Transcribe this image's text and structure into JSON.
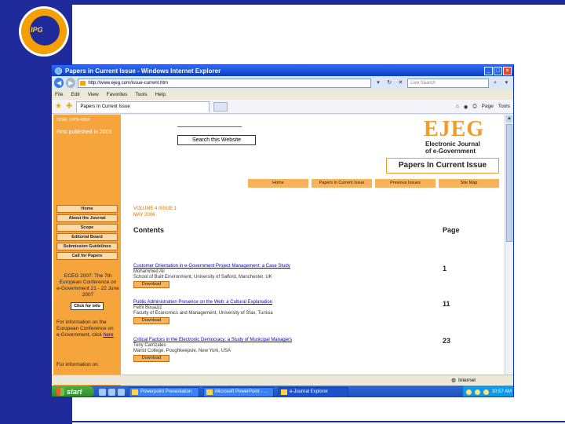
{
  "browser": {
    "window_title": "Papers in Current Issue - Windows Internet Explorer",
    "url": "http://www.ejeg.com/issue-current.htm",
    "search_placeholder": "Live Search",
    "menu": [
      "File",
      "Edit",
      "View",
      "Favorites",
      "Tools",
      "Help"
    ],
    "tab_label": "Papers In Current Issue",
    "tool_labels": {
      "page": "Page",
      "tools": "Tools"
    },
    "status_text": "",
    "status_zone": "Internet"
  },
  "site": {
    "issn": "ISSN: 1479-439X",
    "first_published": "First published in 2003",
    "search_button": "Search this Website",
    "logo": "EJEG",
    "logo_sub_1": "Electronic Journal",
    "logo_sub_2": "of e-Government",
    "page_heading": "Papers In Current Issue",
    "top_nav": [
      "Home",
      "Papers in Current Issue",
      "Previous Issues",
      "Site Map"
    ],
    "side_nav": [
      "Home",
      "About the Journal",
      "Scope",
      "Editorial Board",
      "Submission Guidelines",
      "Call for Papers"
    ],
    "side_note": "ECEG 2007: The 7th European Conference on e-Government 21 - 22 June 2007",
    "click_info": "Click for info",
    "info_text_1": "For information on the European Conference on e-Government, click",
    "info_link": "here",
    "info_text_2": "For information on"
  },
  "issue": {
    "volume": "VOLUME 4 ISSUE 1",
    "date": "MAY 2006",
    "contents_label": "Contents",
    "page_label": "Page",
    "download_label": "Download",
    "papers": [
      {
        "title": "Customer Orientation in e-Government Project Management: a Case Study",
        "author": "Mohammed Ali",
        "affiliation": "School of Built Environment, University of Salford, Manchester, UK",
        "page": "1"
      },
      {
        "title": "Public Administration Presence on the Web: a Cultural Explanation",
        "author": "Fethi Bouaziz",
        "affiliation": "Faculty of Economics and Management, University of Sfax, Tunisia",
        "page": "11"
      },
      {
        "title": "Critical Factors in the Electronic Democracy: a Study of Municipal Managers",
        "author": "Tony Carrizales",
        "affiliation": "Marist College, Poughkeepsie, New York, USA",
        "page": "23"
      }
    ]
  },
  "taskbar": {
    "start": "start",
    "tasks": [
      "Powerpoint Presentation",
      "Microsoft PowerPoint - ...",
      "e-Journal Explorer"
    ],
    "clock": "10:57 AM"
  },
  "slide": {
    "logo_text": "IPG"
  }
}
